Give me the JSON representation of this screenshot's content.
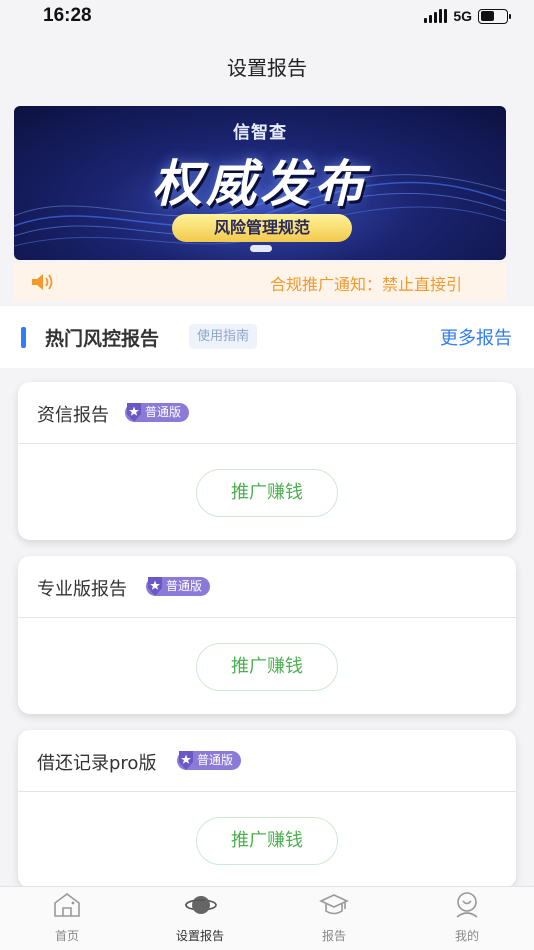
{
  "status_bar": {
    "time": "16:28",
    "network": "5G"
  },
  "nav": {
    "title": "设置报告"
  },
  "banner": {
    "brand": "信智查",
    "headline": "权威发布",
    "pill_text": "风险管理规范"
  },
  "notice": {
    "text": "合规推广通知：禁止直接引"
  },
  "section": {
    "title": "热门风控报告",
    "guide_label": "使用指南",
    "more_label": "更多报告"
  },
  "cards": [
    {
      "title": "资信报告",
      "tier": "普通版",
      "button": "推广赚钱"
    },
    {
      "title": "专业版报告",
      "tier": "普通版",
      "button": "推广赚钱"
    },
    {
      "title": "借还记录pro版",
      "tier": "普通版",
      "button": "推广赚钱"
    }
  ],
  "tab_bar": [
    {
      "label": "首页",
      "icon": "home-icon"
    },
    {
      "label": "设置报告",
      "icon": "planet-icon",
      "active": true
    },
    {
      "label": "报告",
      "icon": "graduation-cap-icon"
    },
    {
      "label": "我的",
      "icon": "profile-icon"
    }
  ],
  "colors": {
    "accent_blue": "#2f7ef5",
    "promo_green": "#4caf50",
    "notice_orange": "#f29a2e",
    "tier_purple": "#8c7ad8"
  }
}
